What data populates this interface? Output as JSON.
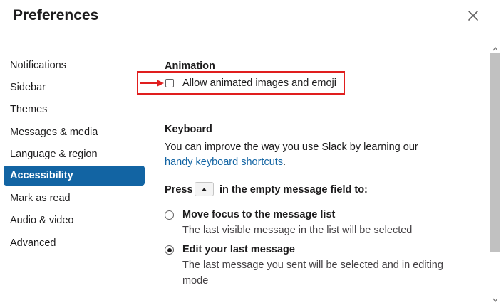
{
  "window": {
    "title": "Preferences",
    "close_icon": "close-icon"
  },
  "sidebar": {
    "items": [
      {
        "label": "Notifications"
      },
      {
        "label": "Sidebar"
      },
      {
        "label": "Themes"
      },
      {
        "label": "Messages & media"
      },
      {
        "label": "Language & region"
      },
      {
        "label": "Accessibility",
        "active": true
      },
      {
        "label": "Mark as read"
      },
      {
        "label": "Audio & video"
      },
      {
        "label": "Advanced"
      }
    ]
  },
  "animation": {
    "title": "Animation",
    "checkbox_label": "Allow animated images and emoji",
    "checked": false
  },
  "keyboard": {
    "title": "Keyboard",
    "description": "You can improve the way you use Slack by learning our",
    "link_text": "handy keyboard shortcuts",
    "link_suffix": ".",
    "press_prefix": "Press",
    "press_suffix": "in the empty message field to:",
    "key_icon": "arrow-up-icon",
    "options": [
      {
        "label": "Move focus to the message list",
        "description": "The last visible message in the list will be selected",
        "checked": false
      },
      {
        "label": "Edit your last message",
        "description_line1": "The last message you sent will be selected and in editing",
        "description_line2": "mode",
        "checked": true
      }
    ]
  },
  "colors": {
    "accent": "#1264a3",
    "highlight": "#e01e1e"
  }
}
